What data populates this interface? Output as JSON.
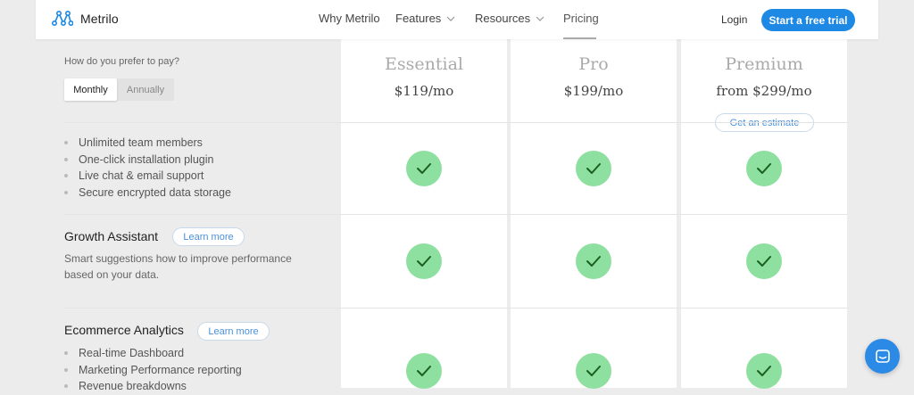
{
  "header": {
    "brand": "Metrilo",
    "nav": [
      {
        "label": "Why Metrilo",
        "has_dropdown": false
      },
      {
        "label": "Features",
        "has_dropdown": true
      },
      {
        "label": "Resources",
        "has_dropdown": true
      },
      {
        "label": "Pricing",
        "has_dropdown": false,
        "active": true
      }
    ],
    "login_label": "Login",
    "trial_label": "Start a free trial"
  },
  "payment": {
    "prompt": "How do you prefer to pay?",
    "options": [
      "Monthly",
      "Annually"
    ],
    "selected": "Monthly"
  },
  "plans": [
    {
      "name": "Essential",
      "price": "$119/mo"
    },
    {
      "name": "Pro",
      "price": "$199/mo"
    },
    {
      "name": "Premium",
      "price": "from $299/mo",
      "estimate_label": "Get an estimate"
    }
  ],
  "base_features": [
    "Unlimited team members",
    "One-click installation plugin",
    "Live chat & email support",
    "Secure encrypted data storage"
  ],
  "sections": {
    "growth": {
      "title": "Growth Assistant",
      "learn_more": "Learn more",
      "description": "Smart suggestions how to improve performance based on your data."
    },
    "analytics": {
      "title": "Ecommerce Analytics",
      "learn_more": "Learn more",
      "items": [
        "Real-time Dashboard",
        "Marketing Performance reporting",
        "Revenue breakdowns"
      ]
    }
  },
  "included": {
    "base_features": [
      true,
      true,
      true
    ],
    "growth": [
      true,
      true,
      true
    ],
    "analytics": [
      true,
      true,
      true
    ]
  },
  "colors": {
    "accent": "#1e88e5",
    "check_bg": "#8ee0a0",
    "check_mark": "#1b5e20",
    "page_bg": "#ececec"
  },
  "icons": {
    "logo": "metrilo-logo-icon",
    "dropdown": "chevron-down-icon",
    "check": "check-icon",
    "chat": "chat-icon"
  }
}
